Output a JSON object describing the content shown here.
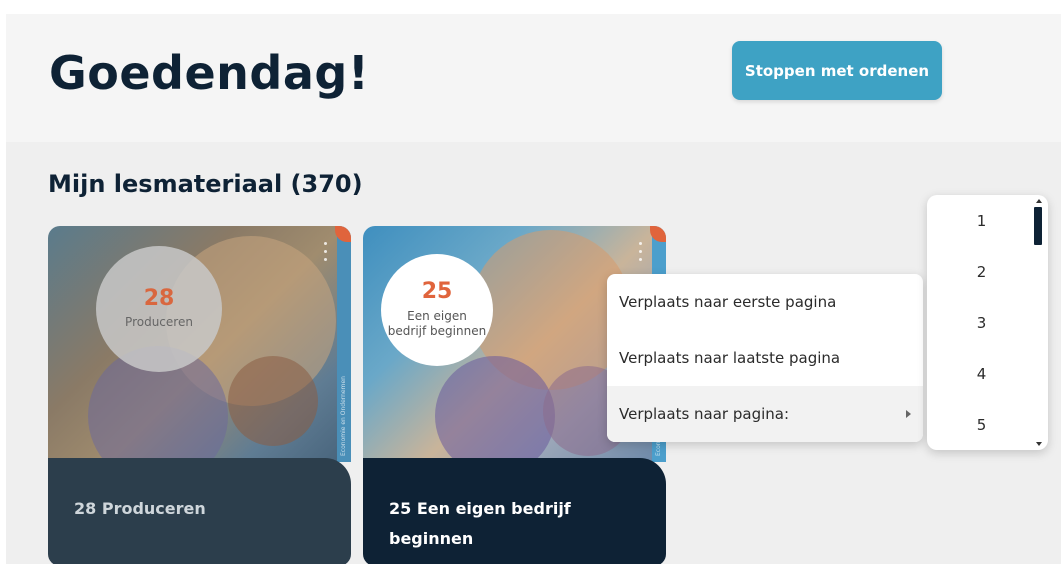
{
  "header": {
    "greeting": "Goedendag!",
    "stop_button_label": "Stoppen met ordenen"
  },
  "section": {
    "title": "Mijn lesmateriaal (370)"
  },
  "cards": [
    {
      "badge_number": "28",
      "badge_label": "Produceren",
      "title": "28 Produceren",
      "side_text": "Economie en Ondernemen"
    },
    {
      "badge_number": "25",
      "badge_label": "Een eigen bedrijf beginnen",
      "title": "25 Een eigen bedrijf beginnen",
      "side_text": "Economie en Ondernemen"
    }
  ],
  "context_menu": {
    "items": [
      {
        "label": "Verplaats naar eerste pagina"
      },
      {
        "label": "Verplaats naar laatste pagina"
      },
      {
        "label": "Verplaats naar pagina:"
      }
    ]
  },
  "page_list": {
    "items": [
      "1",
      "2",
      "3",
      "4",
      "5"
    ]
  },
  "colors": {
    "accent": "#3ea2c4",
    "navy": "#0e2235",
    "orange": "#e0643c"
  },
  "icons": {
    "submenu": "chevron-right-icon",
    "card_menu": "more-vertical-icon"
  }
}
